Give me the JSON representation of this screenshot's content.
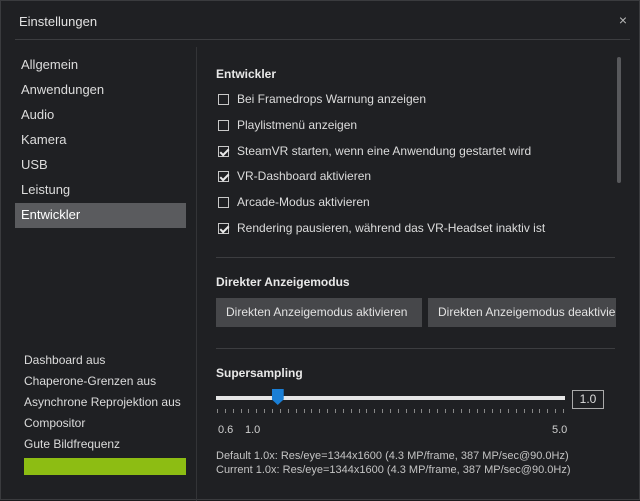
{
  "window": {
    "title": "Einstellungen",
    "close_glyph": "×"
  },
  "sidebar": {
    "items": [
      {
        "label": "Allgemein",
        "active": false
      },
      {
        "label": "Anwendungen",
        "active": false
      },
      {
        "label": "Audio",
        "active": false
      },
      {
        "label": "Kamera",
        "active": false
      },
      {
        "label": "USB",
        "active": false
      },
      {
        "label": "Leistung",
        "active": false
      },
      {
        "label": "Entwickler",
        "active": true
      }
    ]
  },
  "status": {
    "lines": [
      "Dashboard aus",
      "Chaperone-Grenzen aus",
      "Asynchrone Reprojektion aus",
      "Compositor",
      "Gute Bildfrequenz"
    ],
    "bar_color": "#8dbd13"
  },
  "developer": {
    "title": "Entwickler",
    "options": [
      {
        "label": "Bei Framedrops Warnung anzeigen",
        "checked": false
      },
      {
        "label": "Playlistmenü anzeigen",
        "checked": false
      },
      {
        "label": "SteamVR starten, wenn eine Anwendung gestartet wird",
        "checked": true
      },
      {
        "label": "VR-Dashboard aktivieren",
        "checked": true
      },
      {
        "label": "Arcade-Modus aktivieren",
        "checked": false
      },
      {
        "label": "Rendering pausieren, während das VR-Headset inaktiv ist",
        "checked": true
      }
    ]
  },
  "direct_mode": {
    "title": "Direkter Anzeigemodus",
    "enable_label": "Direkten Anzeigemodus aktivieren",
    "disable_label": "Direkten Anzeigemodus deaktivieren"
  },
  "supersampling": {
    "title": "Supersampling",
    "value_text": "1.0",
    "value": 1.0,
    "min": 0.6,
    "max": 5.0,
    "tick_labels": [
      "0.6",
      "1.0",
      "5.0"
    ],
    "default_info": "Default 1.0x: Res/eye=1344x1600 (4.3 MP/frame, 387 MP/sec@90.0Hz)",
    "current_info": "Current 1.0x: Res/eye=1344x1600 (4.3 MP/frame, 387 MP/sec@90.0Hz)"
  },
  "colors": {
    "accent": "#1a7fd6",
    "status_good": "#8dbd13",
    "active_nav": "#5a5b5e"
  }
}
